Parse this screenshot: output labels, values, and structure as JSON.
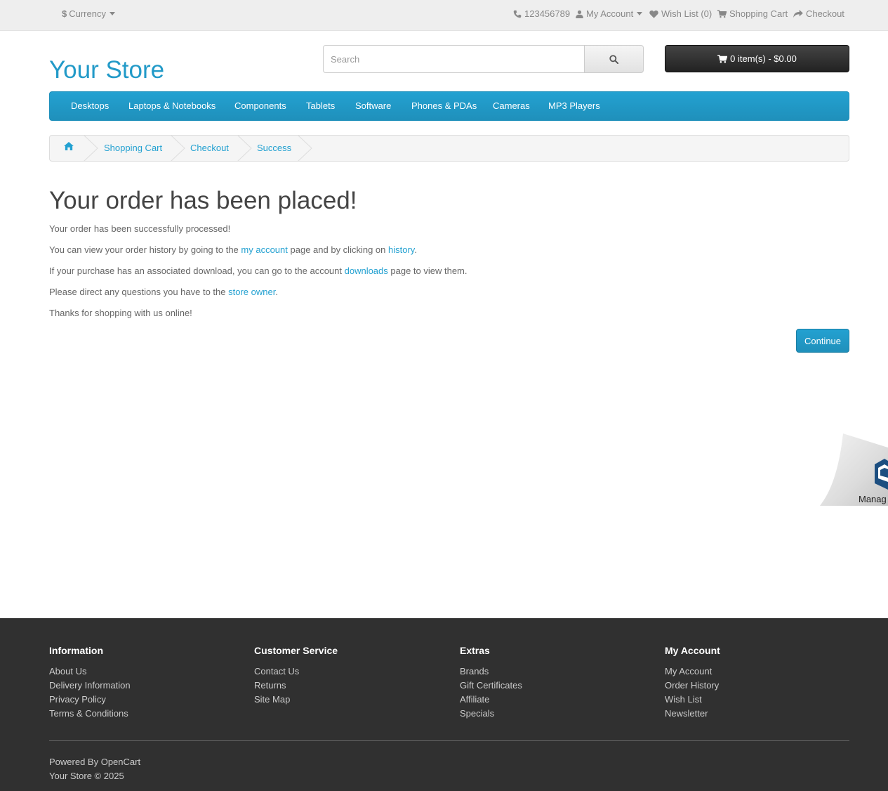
{
  "topbar": {
    "currency_symbol": "$",
    "currency_label": "Currency",
    "phone": "123456789",
    "my_account": "My Account",
    "wish_list": "Wish List (0)",
    "shopping_cart": "Shopping Cart",
    "checkout": "Checkout"
  },
  "header": {
    "logo": "Your Store",
    "search_placeholder": "Search",
    "cart_summary": "0 item(s) - $0.00"
  },
  "menu": [
    "Desktops",
    "Laptops & Notebooks",
    "Components",
    "Tablets",
    "Software",
    "Phones & PDAs",
    "Cameras",
    "MP3 Players"
  ],
  "breadcrumb": [
    "Shopping Cart",
    "Checkout",
    "Success"
  ],
  "content": {
    "title": "Your order has been placed!",
    "line1": "Your order has been successfully processed!",
    "line2_a": "You can view your order history by going to the ",
    "line2_link1": "my account",
    "line2_b": " page and by clicking on ",
    "line2_link2": "history",
    "line2_c": ".",
    "line3_a": "If your purchase has an associated download, you can go to the account ",
    "line3_link": "downloads",
    "line3_b": " page to view them.",
    "line4_a": "Please direct any questions you have to the ",
    "line4_link": "store owner",
    "line4_b": ".",
    "line5": "Thanks for shopping with us online!",
    "continue": "Continue"
  },
  "corner_widget": {
    "label": "Manag"
  },
  "footer": {
    "information": {
      "heading": "Information",
      "links": [
        "About Us",
        "Delivery Information",
        "Privacy Policy",
        "Terms & Conditions"
      ]
    },
    "customer_service": {
      "heading": "Customer Service",
      "links": [
        "Contact Us",
        "Returns",
        "Site Map"
      ]
    },
    "extras": {
      "heading": "Extras",
      "links": [
        "Brands",
        "Gift Certificates",
        "Affiliate",
        "Specials"
      ]
    },
    "my_account": {
      "heading": "My Account",
      "links": [
        "My Account",
        "Order History",
        "Wish List",
        "Newsletter"
      ]
    },
    "powered_by": "Powered By ",
    "powered_link": "OpenCart",
    "copyright": "Your Store © 2025"
  },
  "colors": {
    "accent": "#23a1d1",
    "footer_bg": "#303030",
    "topbar_bg": "#eeeeee",
    "cart_bg": "#333333"
  },
  "icons": {
    "currency": "dollar-icon",
    "phone": "phone-icon",
    "account": "user-icon",
    "wishlist": "heart-icon",
    "cart": "cart-icon",
    "checkout": "share-icon",
    "search": "search-icon",
    "home": "home-icon"
  }
}
